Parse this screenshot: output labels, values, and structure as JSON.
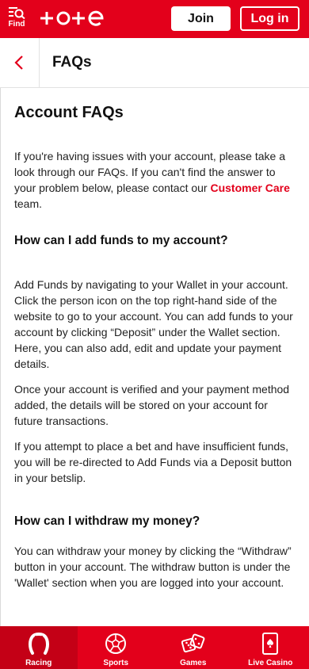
{
  "header": {
    "find_label": "Find",
    "join_label": "Join",
    "login_label": "Log in"
  },
  "subheader": {
    "title": "FAQs"
  },
  "content": {
    "heading": "Account FAQs",
    "intro_before": "If you're having issues with your account, please take a look through our FAQs. If you can't find the answer to your problem below, please contact our ",
    "intro_link": "Customer Care",
    "intro_after": " team.",
    "q1": "How can I add funds to my account?",
    "q1_p1": "Add Funds by navigating to your Wallet in your account. Click the person icon on the top right-hand side of the website to go to your account. You can add funds to your account by clicking “Deposit” under the Wallet section. Here, you can also add, edit and update your payment details.",
    "q1_p2": "Once your account is verified and your payment method added, the details will be stored on your account for future transactions.",
    "q1_p3": "If you attempt to place a bet and have insufficient funds, you will be re-directed to Add Funds via a Deposit button in your betslip.",
    "q2": "How can I withdraw my money?",
    "q2_p1": "You can withdraw your money by clicking the “Withdraw” button in your account. The withdraw button is under the 'Wallet' section when you are logged into your account."
  },
  "bottom_nav": {
    "items": [
      {
        "label": "Racing",
        "icon": "horseshoe-icon",
        "active": true
      },
      {
        "label": "Sports",
        "icon": "football-icon",
        "active": false
      },
      {
        "label": "Games",
        "icon": "dice-icon",
        "active": false
      },
      {
        "label": "Live Casino",
        "icon": "playing-card-icon",
        "active": false
      }
    ]
  },
  "colors": {
    "brand_red": "#e3001b",
    "active_tab": "#c40016",
    "text": "#111111",
    "divider": "#e2e2e2"
  }
}
